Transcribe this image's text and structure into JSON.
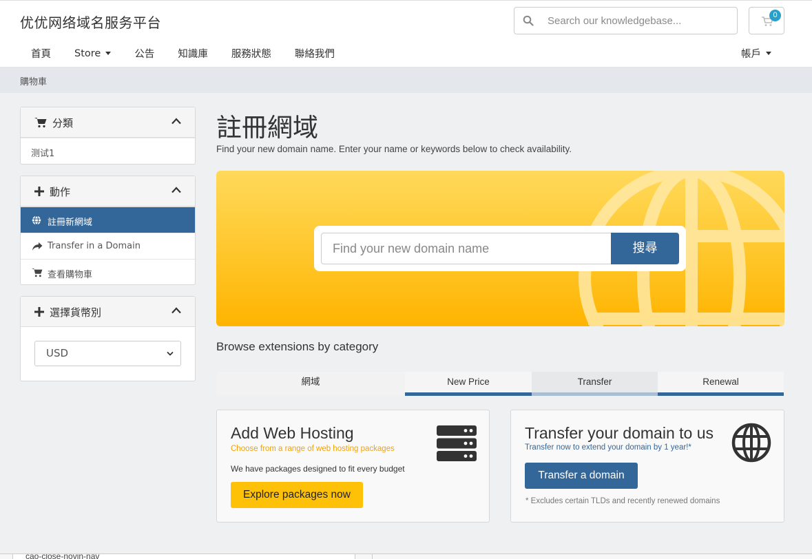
{
  "header": {
    "logo": "优优网络域名服务平台",
    "search_placeholder": "Search our knowledgebase...",
    "cart_count": "0"
  },
  "nav": {
    "items": [
      {
        "label": "首頁"
      },
      {
        "label": "Store"
      },
      {
        "label": "公告"
      },
      {
        "label": "知識庫"
      },
      {
        "label": "服務狀態"
      },
      {
        "label": "聯絡我們"
      }
    ],
    "account": "帳戶"
  },
  "breadcrumb": "購物車",
  "sidebar": {
    "categories": {
      "title": "分類",
      "items": [
        "测试1"
      ]
    },
    "actions": {
      "title": "動作",
      "items": [
        {
          "label": "註冊新網域",
          "icon": "globe-icon"
        },
        {
          "label": "Transfer in a Domain",
          "icon": "share-icon"
        },
        {
          "label": "查看購物車",
          "icon": "cart-icon"
        }
      ]
    },
    "currency": {
      "title": "選擇貨幣別",
      "selected": "USD"
    }
  },
  "main": {
    "title": "註冊網域",
    "subtitle": "Find your new domain name. Enter your name or keywords below to check availability.",
    "hero": {
      "placeholder": "Find your new domain name",
      "button": "搜尋"
    },
    "browse_title": "Browse extensions by category",
    "tabs": [
      "網域",
      "New Price",
      "Transfer",
      "Renewal"
    ],
    "hosting": {
      "title": "Add Web Hosting",
      "tagline": "Choose from a range of web hosting packages",
      "desc": "We have packages designed to fit every budget",
      "button": "Explore packages now"
    },
    "transfer": {
      "title": "Transfer your domain to us",
      "tagline": "Transfer now to extend your domain by 1 year!*",
      "button": "Transfer a domain",
      "note": "* Excludes certain TLDs and recently renewed domains"
    }
  },
  "bottom": {
    "text": "cao-close-novin-nav"
  },
  "colors": {
    "primary": "#336699",
    "accent": "#ffc107",
    "badge": "#2a9fc7",
    "tagline_orange": "#f0a30a",
    "tagline_blue": "#336699"
  }
}
